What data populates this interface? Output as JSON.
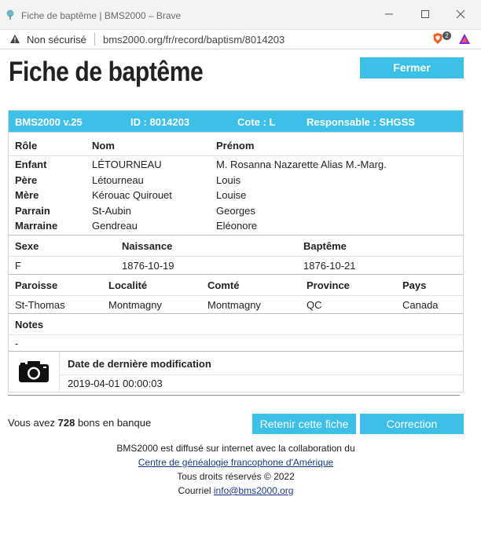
{
  "window": {
    "title": "Fiche de baptême | BMS2000 – Brave",
    "controls": [
      "minimize",
      "maximize",
      "close"
    ]
  },
  "browser": {
    "security_text": "Non sécurisé",
    "url": "bms2000.org/fr/record/baptism/8014203",
    "shield_count": "2"
  },
  "page": {
    "title": "Fiche de baptême",
    "close_button": "Fermer"
  },
  "record": {
    "header": {
      "version": "BMS2000 v.25",
      "id": "ID : 8014203",
      "cote": "Cote : L",
      "responsable": "Responsable : SHGSS"
    },
    "people_columns": [
      "Rôle",
      "Nom",
      "Prénom"
    ],
    "people": [
      {
        "role": "Enfant",
        "nom": "LÉTOURNEAU",
        "prenom": "M. Rosanna Nazarette Alias M.-Marg."
      },
      {
        "role": "Père",
        "nom": "Létourneau",
        "prenom": "Louis"
      },
      {
        "role": "Mère",
        "nom": "Kérouac Quirouet",
        "prenom": "Louise"
      },
      {
        "role": "Parrain",
        "nom": "St-Aubin",
        "prenom": "Georges"
      },
      {
        "role": "Marraine",
        "nom": "Gendreau",
        "prenom": "Eléonore"
      }
    ],
    "vital_columns": [
      "Sexe",
      "Naissance",
      "Baptême"
    ],
    "vital": {
      "sexe": "F",
      "naissance": "1876-10-19",
      "bapteme": "1876-10-21"
    },
    "place_columns": [
      "Paroisse",
      "Localité",
      "Comté",
      "Province",
      "Pays"
    ],
    "place": {
      "paroisse": "St-Thomas",
      "localite": "Montmagny",
      "comte": "Montmagny",
      "province": "QC",
      "pays": "Canada"
    },
    "notes_label": "Notes",
    "notes_value": "-",
    "modif_label": "Date de dernière modification",
    "modif_value": "2019-04-01 00:00:03"
  },
  "bank": {
    "prefix": "Vous avez",
    "count": "728",
    "suffix": "bons en banque"
  },
  "actions": {
    "keep": "Retenir cette fiche",
    "correction": "Correction"
  },
  "footer": {
    "line1": "BMS2000 est diffusé sur internet avec la collaboration du",
    "link": "Centre de généalogie francophone d'Amérique",
    "rights": "Tous droits réservés © 2022",
    "mail_label": "Courriel",
    "mail": "info@bms2000.org"
  },
  "colors": {
    "accent": "#3cc0e7",
    "link": "#1a3c8c"
  }
}
